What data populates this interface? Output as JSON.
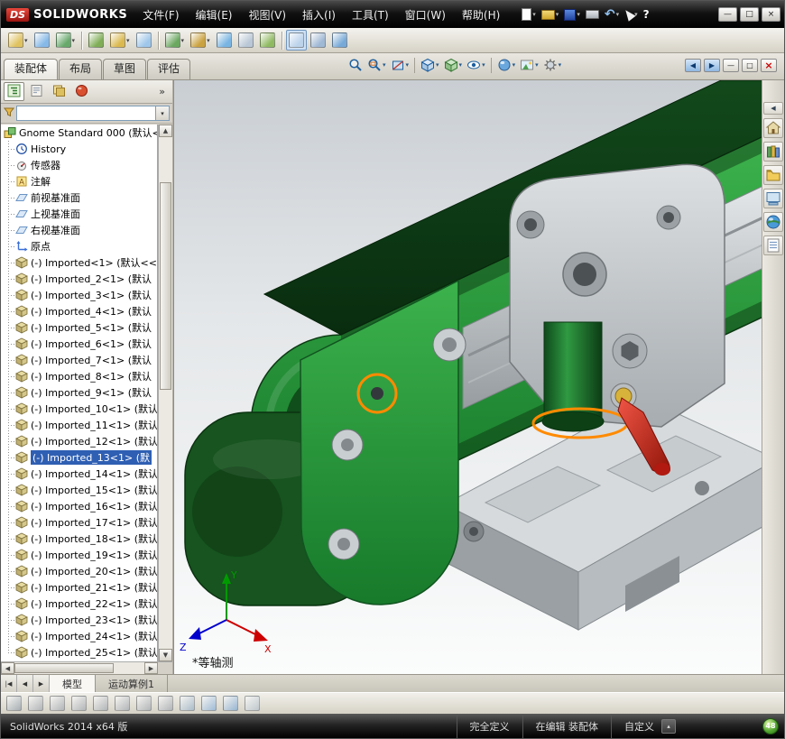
{
  "colors": {
    "selection": "#2f5fb3",
    "highlight": "#ff8a00",
    "belt_green": "#1e8030",
    "handle_red": "#cc2218"
  },
  "title_bar": {
    "logo_mark": "DS",
    "logo_text": "SOLIDWORKS",
    "menus": [
      {
        "name": "file",
        "label": "文件(F)"
      },
      {
        "name": "edit",
        "label": "编辑(E)"
      },
      {
        "name": "view",
        "label": "视图(V)"
      },
      {
        "name": "insert",
        "label": "插入(I)"
      },
      {
        "name": "tools",
        "label": "工具(T)"
      },
      {
        "name": "window",
        "label": "窗口(W)"
      },
      {
        "name": "help",
        "label": "帮助(H)"
      }
    ],
    "quick_icons": [
      {
        "name": "new",
        "style": "page",
        "dd": 1
      },
      {
        "name": "open",
        "style": "folder",
        "dd": 1
      },
      {
        "name": "save",
        "style": "floppy",
        "dd": 1
      },
      {
        "name": "print",
        "style": "printer"
      },
      {
        "name": "undo",
        "style": "undo",
        "glyph": "↶",
        "dd": 1
      },
      {
        "name": "select",
        "style": "cursor",
        "dd": 1
      },
      {
        "name": "help",
        "style": "help",
        "glyph": "?"
      }
    ],
    "window_buttons": [
      {
        "name": "minimize",
        "glyph": "—"
      },
      {
        "name": "maximize",
        "glyph": "□"
      },
      {
        "name": "close",
        "glyph": "×"
      }
    ]
  },
  "toolbar2": {
    "icons": [
      {
        "name": "insert-components",
        "c": "#e0c25f",
        "dd": 1
      },
      {
        "name": "mate",
        "c": "#86b9e8"
      },
      {
        "name": "linear-component-pattern",
        "c": "#67a96b",
        "dd": 1
      },
      {
        "sep": 1
      },
      {
        "name": "smart-fasteners",
        "c": "#7fae57"
      },
      {
        "name": "move-component",
        "c": "#dbb94f",
        "dd": 1
      },
      {
        "name": "show-hidden-components",
        "c": "#9ec7ea"
      },
      {
        "sep": 1
      },
      {
        "name": "assembly-features",
        "c": "#6aa860",
        "dd": 1
      },
      {
        "name": "reference-geometry",
        "c": "#caa23f",
        "dd": 1
      },
      {
        "name": "new-motion-study",
        "c": "#79b5e3"
      },
      {
        "name": "bill-of-materials",
        "c": "#b9c7d6"
      },
      {
        "name": "exploded-view",
        "c": "#8fba62"
      },
      {
        "sep": 1
      },
      {
        "name": "instant-3d",
        "c": "#bcd3ea",
        "active": 1
      },
      {
        "name": "large-assembly-mode",
        "c": "#9fb8d4"
      },
      {
        "name": "external-references",
        "c": "#76a9d8"
      }
    ]
  },
  "command_tabs": {
    "tabs": [
      {
        "name": "assembly",
        "label": "装配体",
        "active": true
      },
      {
        "name": "layout",
        "label": "布局"
      },
      {
        "name": "sketch",
        "label": "草图"
      },
      {
        "name": "evaluate",
        "label": "评估"
      }
    ]
  },
  "headsup": {
    "icons": [
      {
        "name": "zoom-fit",
        "kind": "mag"
      },
      {
        "name": "zoom-to-area",
        "kind": "magarea",
        "dd": 1
      },
      {
        "name": "section-view",
        "kind": "section",
        "dd": 1
      },
      {
        "sep": 1
      },
      {
        "name": "view-orientation",
        "kind": "cube",
        "dd": 1
      },
      {
        "name": "display-style",
        "kind": "shaded",
        "dd": 1
      },
      {
        "name": "hide-show-items",
        "kind": "eye",
        "dd": 1
      },
      {
        "sep": 1
      },
      {
        "name": "edit-appearance",
        "kind": "sphere",
        "dd": 1
      },
      {
        "name": "apply-scene",
        "kind": "scene",
        "dd": 1
      },
      {
        "name": "view-settings",
        "kind": "settings",
        "dd": 1
      }
    ]
  },
  "doc_controls": {
    "buttons": [
      {
        "name": "previous-window",
        "glyph": "◀",
        "nav": 1
      },
      {
        "name": "next-window",
        "glyph": "▶",
        "nav": 1
      },
      {
        "name": "doc-minimize",
        "glyph": "—"
      },
      {
        "name": "doc-restore",
        "glyph": "□"
      },
      {
        "name": "doc-close",
        "glyph": "×",
        "danger": 1
      }
    ]
  },
  "left_panel": {
    "panel_tabs": [
      {
        "name": "featuremanager-tab",
        "kind": "tree",
        "active": true
      },
      {
        "name": "propertymanager-tab",
        "kind": "props"
      },
      {
        "name": "configurationmanager-tab",
        "kind": "config"
      },
      {
        "name": "displaymanager-tab",
        "kind": "ball"
      }
    ],
    "overflow_glyph": "»",
    "scroll": {
      "up": "▲",
      "down": "▼",
      "left": "◀",
      "right": "▶"
    }
  },
  "feature_tree": {
    "items": [
      {
        "icon": "asm",
        "label": "Gnome Standard 000 (默认<"
      },
      {
        "icon": "hist",
        "label": "History",
        "child": 1
      },
      {
        "icon": "sens",
        "label": "传感器",
        "child": 1
      },
      {
        "icon": "ann",
        "label": "注解",
        "child": 1
      },
      {
        "icon": "plane",
        "label": "前视基准面",
        "child": 1
      },
      {
        "icon": "plane",
        "label": "上视基准面",
        "child": 1
      },
      {
        "icon": "plane",
        "label": "右视基准面",
        "child": 1
      },
      {
        "icon": "origin",
        "label": "原点",
        "child": 1
      },
      {
        "icon": "part",
        "label": "(-) Imported<1> (默认<<",
        "child": 1
      },
      {
        "icon": "part",
        "label": "(-) Imported_2<1> (默认",
        "child": 1
      },
      {
        "icon": "part",
        "label": "(-) Imported_3<1> (默认",
        "child": 1
      },
      {
        "icon": "part",
        "label": "(-) Imported_4<1> (默认",
        "child": 1
      },
      {
        "icon": "part",
        "label": "(-) Imported_5<1> (默认",
        "child": 1
      },
      {
        "icon": "part",
        "label": "(-) Imported_6<1> (默认",
        "child": 1
      },
      {
        "icon": "part",
        "label": "(-) Imported_7<1> (默认",
        "child": 1
      },
      {
        "icon": "part",
        "label": "(-) Imported_8<1> (默认",
        "child": 1
      },
      {
        "icon": "part",
        "label": "(-) Imported_9<1> (默认",
        "child": 1
      },
      {
        "icon": "part",
        "label": "(-) Imported_10<1> (默认",
        "child": 1
      },
      {
        "icon": "part",
        "label": "(-) Imported_11<1> (默认",
        "child": 1
      },
      {
        "icon": "part",
        "label": "(-) Imported_12<1> (默认",
        "child": 1
      },
      {
        "icon": "part",
        "label": "(-) Imported_13<1> (默",
        "child": 1,
        "sel": 1
      },
      {
        "icon": "part",
        "label": "(-) Imported_14<1> (默认",
        "child": 1
      },
      {
        "icon": "part",
        "label": "(-) Imported_15<1> (默认",
        "child": 1
      },
      {
        "icon": "part",
        "label": "(-) Imported_16<1> (默认",
        "child": 1
      },
      {
        "icon": "part",
        "label": "(-) Imported_17<1> (默认",
        "child": 1
      },
      {
        "icon": "part",
        "label": "(-) Imported_18<1> (默认",
        "child": 1
      },
      {
        "icon": "part",
        "label": "(-) Imported_19<1> (默认",
        "child": 1
      },
      {
        "icon": "part",
        "label": "(-) Imported_20<1> (默认",
        "child": 1
      },
      {
        "icon": "part",
        "label": "(-) Imported_21<1> (默认",
        "child": 1
      },
      {
        "icon": "part",
        "label": "(-) Imported_22<1> (默认",
        "child": 1
      },
      {
        "icon": "part",
        "label": "(-) Imported_23<1> (默认",
        "child": 1
      },
      {
        "icon": "part",
        "label": "(-) Imported_24<1> (默认",
        "child": 1
      },
      {
        "icon": "part",
        "label": "(-) Imported_25<1> (默认",
        "child": 1
      }
    ]
  },
  "taskpane": {
    "icons": [
      {
        "name": "expand-task-pane",
        "kind": "chevron"
      },
      {
        "name": "solidworks-resources",
        "kind": "home"
      },
      {
        "name": "design-library",
        "kind": "library"
      },
      {
        "name": "file-explorer",
        "kind": "folder"
      },
      {
        "name": "view-palette",
        "kind": "palette"
      },
      {
        "name": "appearances-scenes",
        "kind": "sphere"
      },
      {
        "name": "custom-properties",
        "kind": "props"
      }
    ]
  },
  "bottom_tabs": {
    "nav": [
      {
        "name": "scroll-first",
        "glyph": "|◀"
      },
      {
        "name": "scroll-prev",
        "glyph": "◀"
      },
      {
        "name": "scroll-next",
        "glyph": "▶"
      }
    ],
    "tabs": [
      {
        "name": "model",
        "label": "模型",
        "active": true
      },
      {
        "name": "motion-study-1",
        "label": "运动算例1"
      }
    ]
  },
  "bottom_toolbar": {
    "icons": [
      {
        "name": "sketch",
        "c": "#9aa4ad"
      },
      {
        "name": "smart-dimension",
        "c": "#a8adb3"
      },
      {
        "name": "line",
        "c": "#a8adb3"
      },
      {
        "name": "circle",
        "c": "#a8adb3"
      },
      {
        "name": "arc",
        "c": "#a8adb3"
      },
      {
        "name": "rectangle",
        "c": "#a8adb3"
      },
      {
        "name": "trim-entities",
        "c": "#a8adb3"
      },
      {
        "name": "convert-entities",
        "c": "#a8adb3"
      },
      {
        "name": "offset-entities",
        "c": "#9fb6c9"
      },
      {
        "name": "mirror-entities",
        "c": "#8fb4d8"
      },
      {
        "name": "linear-sketch-pattern",
        "c": "#86add2"
      },
      {
        "name": "display-delete-relations",
        "c": "#b8c4ce"
      }
    ]
  },
  "viewport": {
    "view_label": "*等轴测",
    "triad": {
      "x": "X",
      "y": "Y",
      "z": "Z"
    }
  },
  "status_bar": {
    "app_version": "SolidWorks 2014 x64 版",
    "definition_status": "完全定义",
    "editing_status": "在编辑 装配体",
    "custom_label": "自定义",
    "expand_glyph": "▴",
    "badge": "48"
  }
}
